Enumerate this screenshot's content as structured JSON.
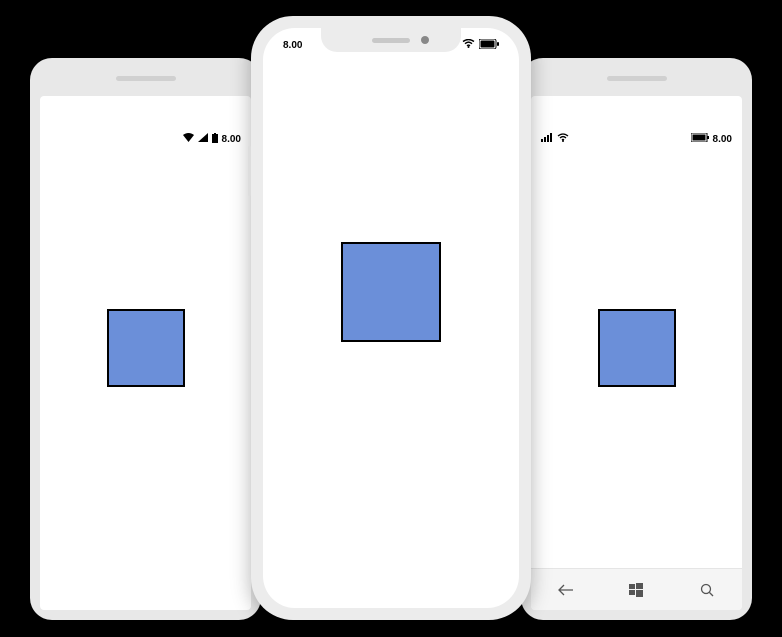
{
  "phones": {
    "left": {
      "platform": "android",
      "status": {
        "time": "8.00"
      },
      "square_color": "#6b8fd9"
    },
    "center": {
      "platform": "ios",
      "status": {
        "time": "8.00"
      },
      "square_color": "#6b8fd9"
    },
    "right": {
      "platform": "windows",
      "status": {
        "time": "8.00"
      },
      "square_color": "#6b8fd9",
      "nav": {
        "back": "back-arrow",
        "home": "windows-logo",
        "search": "search-icon"
      }
    }
  }
}
